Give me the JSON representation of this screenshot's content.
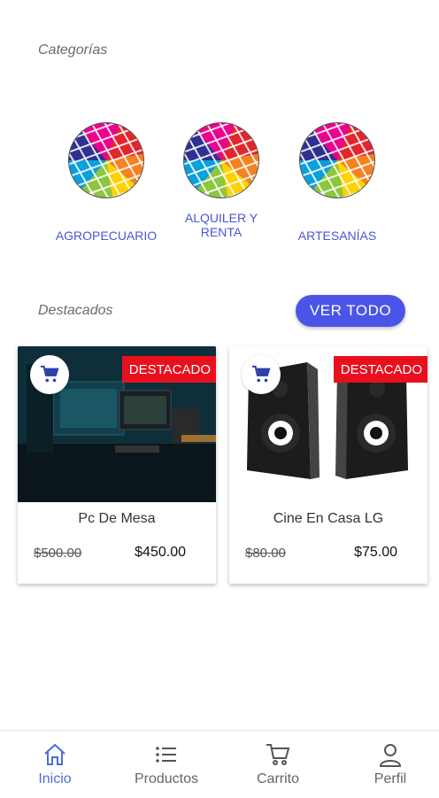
{
  "categories": {
    "title": "Categorías",
    "items": [
      {
        "label": "AGROPECUARIO"
      },
      {
        "label": "ALQUILER Y RENTA"
      },
      {
        "label": "ARTESANÍAS"
      }
    ]
  },
  "featured": {
    "title": "Destacados",
    "see_all_label": "VER TODO",
    "products": [
      {
        "name": "Pc De Mesa",
        "old_price": "$500.00",
        "price": "$450.00",
        "badge": "DESTACADO",
        "image": "desktop-pc-photo"
      },
      {
        "name": "Cine En Casa LG",
        "old_price": "$80.00",
        "price": "$75.00",
        "badge": "DESTACADO",
        "image": "speakers-photo"
      }
    ]
  },
  "bottom_nav": {
    "items": [
      {
        "label": "Inicio",
        "icon": "home-icon",
        "active": true
      },
      {
        "label": "Productos",
        "icon": "list-icon",
        "active": false
      },
      {
        "label": "Carrito",
        "icon": "cart-icon",
        "active": false
      },
      {
        "label": "Perfil",
        "icon": "user-icon",
        "active": false
      }
    ]
  },
  "colors": {
    "accent": "#4a55e8",
    "badge": "#e8101e",
    "active_nav": "#4a6ee0"
  }
}
